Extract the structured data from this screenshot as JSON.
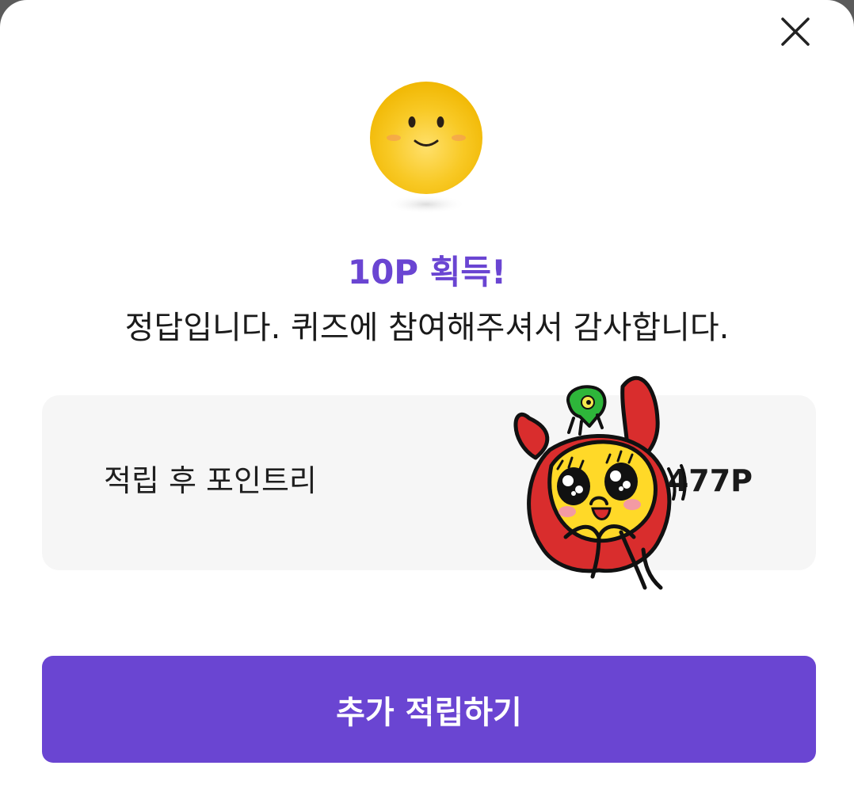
{
  "modal": {
    "reward_title": "10P 획득!",
    "reward_message": "정답입니다. 퀴즈에 참여해주셔서 감사합니다.",
    "points_label": "적립 후 포인트리",
    "points_value_visible": ",477P",
    "cta_label": "추가 적립하기"
  },
  "colors": {
    "accent": "#6a45d2",
    "panel_bg": "#f6f6f6",
    "emoji_yellow": "#f7c61a"
  },
  "icons": {
    "close": "close-icon",
    "emoji": "smiley-emoji",
    "sticker": "character-sticker"
  }
}
